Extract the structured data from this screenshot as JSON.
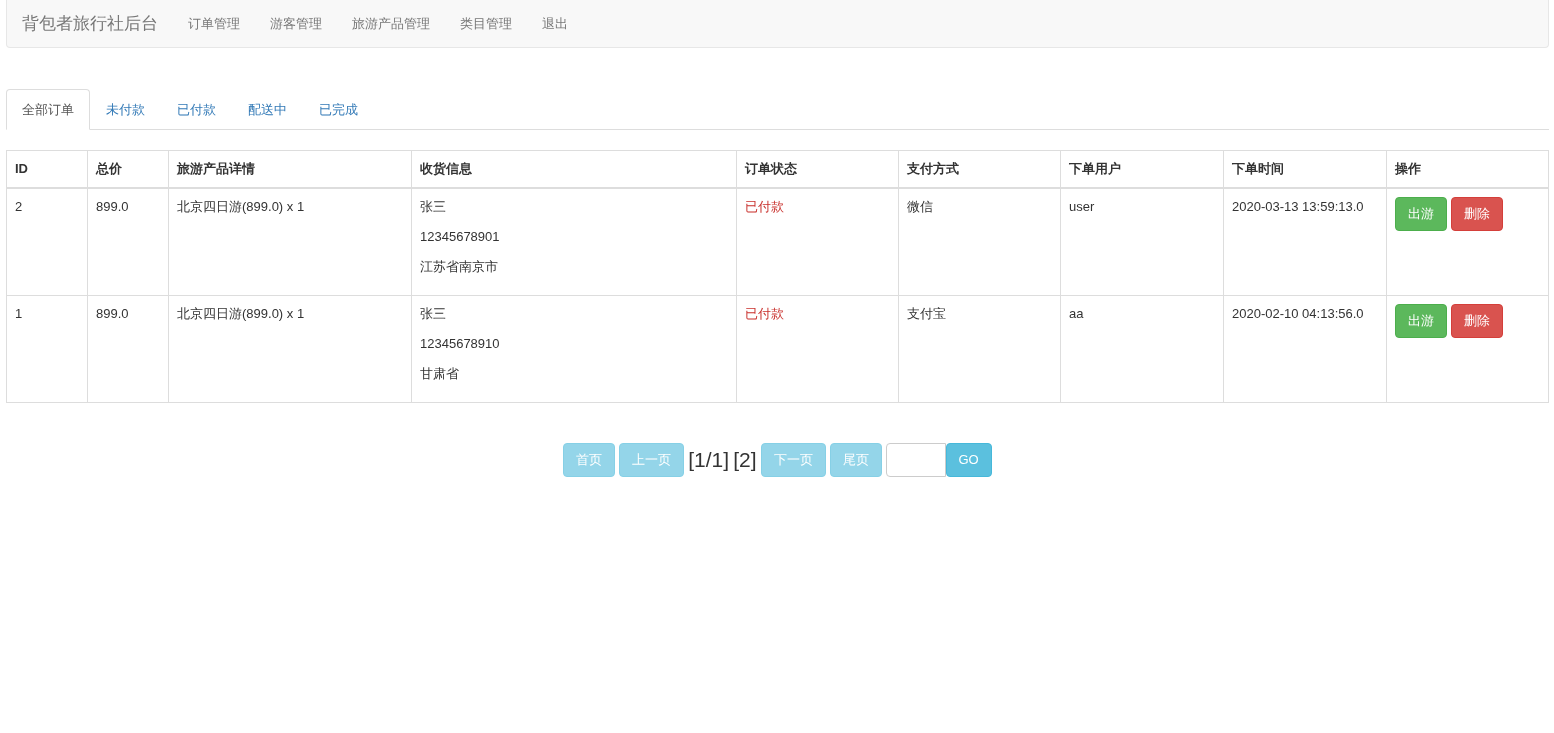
{
  "navbar": {
    "brand": "背包者旅行社后台",
    "links": [
      "订单管理",
      "游客管理",
      "旅游产品管理",
      "类目管理",
      "退出"
    ]
  },
  "tabs": [
    {
      "label": "全部订单",
      "selected": true
    },
    {
      "label": "未付款",
      "selected": false
    },
    {
      "label": "已付款",
      "selected": false
    },
    {
      "label": "配送中",
      "selected": false
    },
    {
      "label": "已完成",
      "selected": false
    }
  ],
  "table": {
    "columns": [
      "ID",
      "总价",
      "旅游产品详情",
      "收货信息",
      "订单状态",
      "支付方式",
      "下单用户",
      "下单时间",
      "操作"
    ],
    "rows": [
      {
        "id": "2",
        "total": "899.0",
        "product": "北京四日游(899.0) x 1",
        "shipping": [
          "张三",
          "12345678901",
          "江苏省南京市"
        ],
        "status": "已付款",
        "payment": "微信",
        "user": "user",
        "time": "2020-03-13 13:59:13.0",
        "actions": [
          {
            "label": "出游",
            "kind": "success"
          },
          {
            "label": "删除",
            "kind": "danger"
          }
        ]
      },
      {
        "id": "1",
        "total": "899.0",
        "product": "北京四日游(899.0) x 1",
        "shipping": [
          "张三",
          "12345678910",
          "甘肃省"
        ],
        "status": "已付款",
        "payment": "支付宝",
        "user": "aa",
        "time": "2020-02-10 04:13:56.0",
        "actions": [
          {
            "label": "出游",
            "kind": "success"
          },
          {
            "label": "删除",
            "kind": "danger"
          }
        ]
      }
    ]
  },
  "pagination": {
    "first": {
      "label": "首页",
      "disabled": true
    },
    "prev": {
      "label": "上一页",
      "disabled": true
    },
    "info": "[1/1]",
    "count": "[2]",
    "next": {
      "label": "下一页",
      "disabled": true
    },
    "last": {
      "label": "尾页",
      "disabled": true
    },
    "go": {
      "label": "GO",
      "disabled": false
    }
  }
}
